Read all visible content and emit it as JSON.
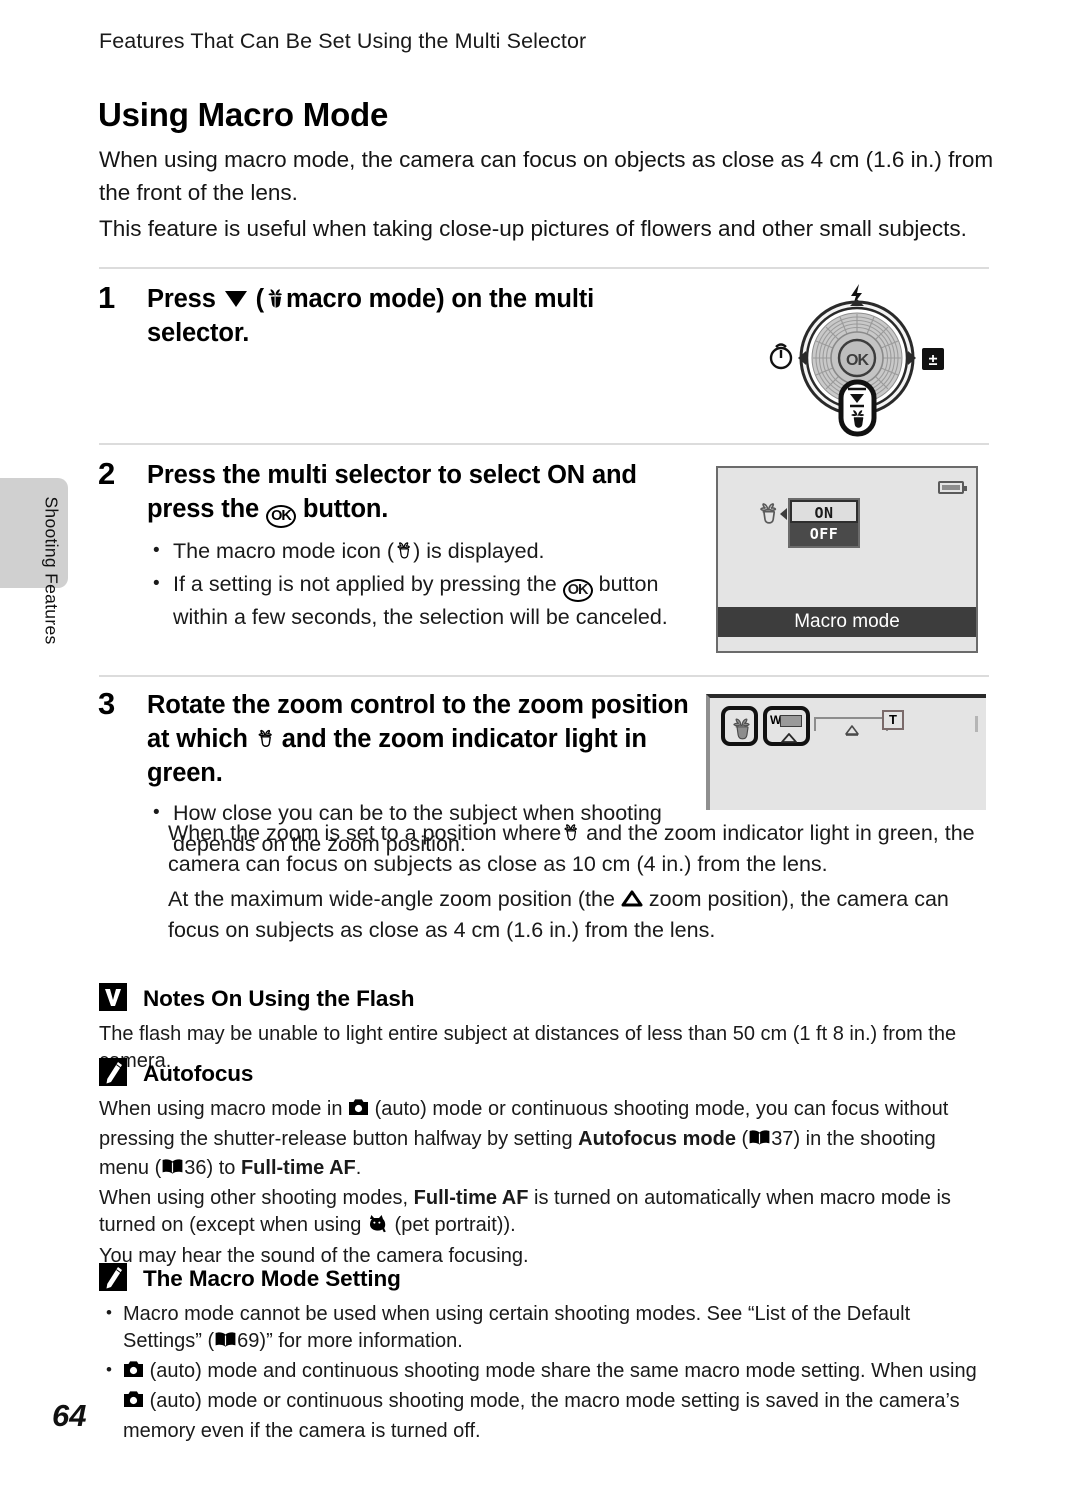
{
  "running_head": "Features That Can Be Set Using the Multi Selector",
  "page_title": "Using Macro Mode",
  "side_tab_label": "Shooting Features",
  "folio": "64",
  "intro": {
    "para1": "When using macro mode, the camera can focus on objects as close as 4 cm (1.6 in.) from the front of the lens.",
    "para2": "This feature is useful when taking close-up pictures of flowers and other small subjects."
  },
  "steps": [
    {
      "number": "1",
      "head_before": "Press",
      "head_mid": "(",
      "head_after": "macro mode) on the multi selector.",
      "icons": [
        "down-triangle-icon",
        "macro-mode-icon"
      ]
    },
    {
      "number": "2",
      "head_a": "Press the multi selector to select",
      "head_b": "ON",
      "head_c": "and press the",
      "head_d": "button.",
      "bullets": [
        {
          "a": "The macro mode icon (",
          "b": ") is displayed."
        },
        {
          "a": "If a setting is not applied by pressing the",
          "b": "button within a few seconds, the selection will be canceled."
        }
      ]
    },
    {
      "number": "3",
      "head_a": "Rotate the zoom control to the zoom position at which",
      "head_b": "and the zoom indicator light in green.",
      "bullets": [
        {
          "a": "How close you can be to the subject when shooting depends on the zoom position."
        }
      ],
      "extra": [
        {
          "a": "When the zoom is set to a position where",
          "b": "and the zoom indicator light in green, the camera can focus on subjects as close as 10 cm (4 in.) from the lens."
        },
        {
          "a": "At the maximum wide-angle zoom position (the",
          "b": "zoom position), the camera can focus on subjects as close as 4 cm (1.6 in.) from the lens."
        }
      ]
    }
  ],
  "lcd_screen": {
    "option_selected": "ON",
    "option_unselected": "OFF",
    "caption": "Macro mode",
    "battery_icon": "battery-icon",
    "macro_icon": "macro-mode-icon"
  },
  "zoom_indicator": {
    "wide_label": "W",
    "tele_label": "T",
    "macro_icon": "macro-mode-icon"
  },
  "dial": {
    "center_label": "OK",
    "top_icon": "flash-icon",
    "left_icon": "self-timer-icon",
    "right_icon": "exposure-compensation-icon",
    "bottom_icon": "macro-mode-icon"
  },
  "notes": [
    {
      "icon": "caution-icon",
      "title": "Notes On Using the Flash",
      "paragraphs": [
        "The flash may be unable to light entire subject at distances of less than 50 cm (1 ft 8 in.) from the camera."
      ]
    },
    {
      "icon": "pencil-note-icon",
      "title": "Autofocus",
      "line1_a": "When using macro mode in",
      "line1_b": "(auto) mode or continuous shooting mode, you can focus without pressing the shutter-release button halfway by setting",
      "line1_bold1": "Autofocus mode",
      "line1_c": "(",
      "line1_ref1": "37",
      "line1_d": ") in the shooting menu (",
      "line1_ref2": "36",
      "line1_e": ") to",
      "line1_bold2": "Full-time AF",
      "line1_f": ".",
      "line2_a": "When using other shooting modes,",
      "line2_bold": "Full-time AF",
      "line2_b": "is turned on automatically when macro mode is turned on (except when using",
      "line2_c": "(pet portrait)).",
      "line3": "You may hear the sound of the camera focusing."
    },
    {
      "icon": "pencil-note-icon",
      "title": "The Macro Mode Setting",
      "bullet1_a": "Macro mode cannot be used when using certain shooting modes. See “List of the Default Settings” (",
      "bullet1_ref": "69",
      "bullet1_b": ")” for more information.",
      "bullet2_a": "(auto) mode and continuous shooting mode share the same macro mode setting. When using",
      "bullet2_b": "(auto) mode or continuous shooting mode, the macro mode setting is saved in the camera’s memory even if the camera is turned off."
    }
  ],
  "colors": {
    "lcd_background": "#e4e4e4",
    "lcd_caption_bar": "#3d3d3d",
    "tab_gray": "#d0d0d0",
    "divider": "#dcdcdc"
  }
}
